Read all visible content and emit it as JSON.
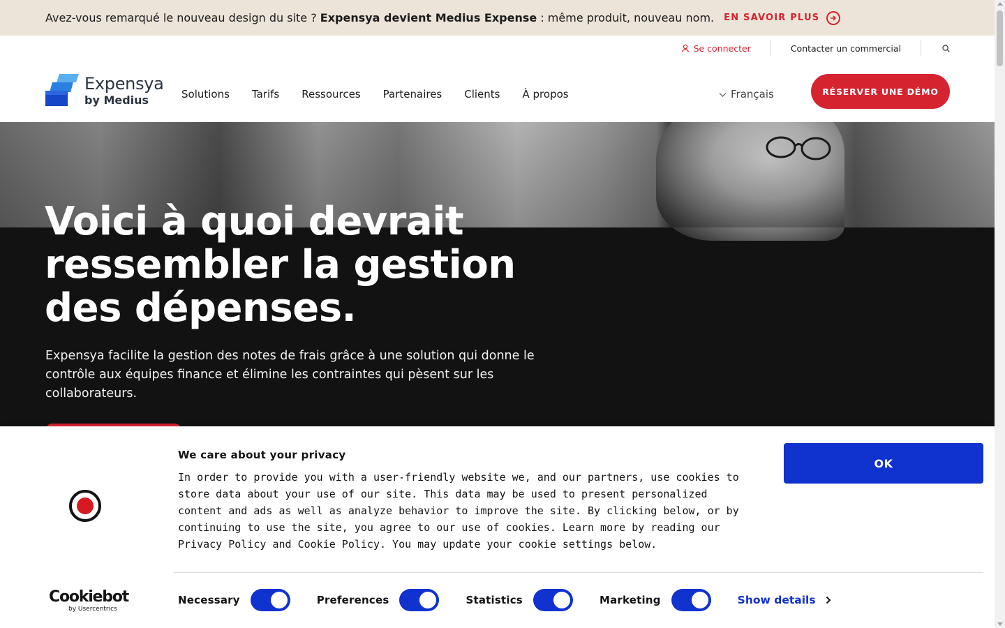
{
  "announcement": {
    "text_before": "Avez-vous remarqué le nouveau design du site ? ",
    "text_bold": "Expensya devient Medius Expense",
    "text_after": " : même produit, nouveau nom.",
    "link_label": "EN SAVOIR PLUS",
    "link_icon": "arrow-right-circle-icon"
  },
  "utility": {
    "login_label": "Se connecter",
    "login_icon": "user-icon",
    "contact_label": "Contacter un commercial",
    "search_icon": "search-icon"
  },
  "nav": {
    "logo_line1": "Expensya",
    "logo_line2": "by Medius",
    "items": [
      "Solutions",
      "Tarifs",
      "Ressources",
      "Partenaires",
      "Clients",
      "À propos"
    ],
    "language": "Français",
    "demo_label": "RÉSERVER UNE DÉMO"
  },
  "hero": {
    "title": "Voici à quoi devrait ressembler la gestion des dépenses.",
    "subtitle": "Expensya facilite la gestion des notes de frais grâce à une solution qui donne le contrôle aux équipes finance et élimine les contraintes qui pèsent sur les collaborateurs."
  },
  "cookie": {
    "title": "We care about your privacy",
    "body": "In order to provide you with a user-friendly website we, and our partners, use cookies to store data about your use of our site. This data may be used to present personalized content and ads as well as analyze behavior to improve the site. By clicking below, or by continuing to use the site, you agree to our use of cookies. Learn more by reading our Privacy Policy and Cookie Policy. You may update your cookie settings below.",
    "ok_label": "OK",
    "brand_name": "Cookiebot",
    "brand_sub": "by Usercentrics",
    "toggles": [
      {
        "label": "Necessary",
        "checked": true
      },
      {
        "label": "Preferences",
        "checked": true
      },
      {
        "label": "Statistics",
        "checked": true
      },
      {
        "label": "Marketing",
        "checked": true
      }
    ],
    "details_label": "Show details"
  },
  "colors": {
    "brand_red": "#d52430",
    "cookie_blue": "#1032cf",
    "announce_bg": "#ece4d9",
    "hero_bg": "#121212"
  }
}
